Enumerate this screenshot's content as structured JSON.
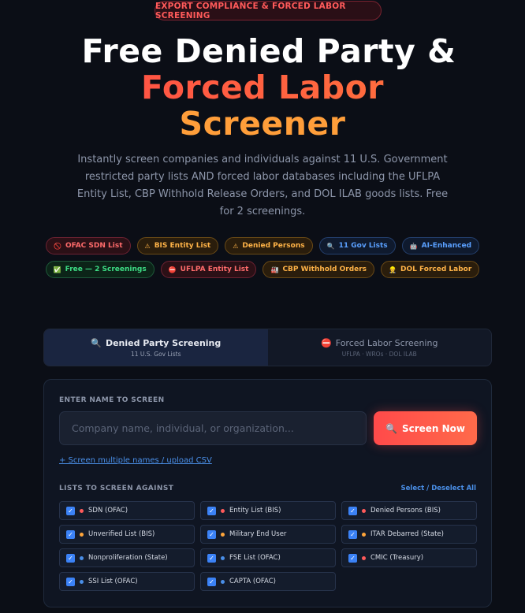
{
  "badge": "EXPORT COMPLIANCE & FORCED LABOR SCREENING",
  "hero": {
    "line1": "Free Denied Party &",
    "line2": "Forced Labor",
    "line3": "Screener"
  },
  "subtitle": "Instantly screen companies and individuals against 11 U.S. Government restricted party lists AND forced labor databases including the UFLPA Entity List, CBP Withhold Release Orders, and DOL ILAB goods lists. Free for 2 screenings.",
  "tags_row1": [
    {
      "icon": "no-entry-icon",
      "glyph": "🚫",
      "label": "OFAC SDN List",
      "style": "red"
    },
    {
      "icon": "warning-icon",
      "glyph": "⚠",
      "label": "BIS Entity List",
      "style": "amber"
    },
    {
      "icon": "warning-icon",
      "glyph": "⚠",
      "label": "Denied Persons",
      "style": "amber"
    },
    {
      "icon": "search-icon",
      "glyph": "🔍",
      "label": "11 Gov Lists",
      "style": "blue"
    },
    {
      "icon": "robot-icon",
      "glyph": "🤖",
      "label": "AI-Enhanced",
      "style": "blue"
    }
  ],
  "tags_row2": [
    {
      "icon": "check-icon",
      "glyph": "✅",
      "label": "Free — 2 Screenings",
      "style": "green"
    },
    {
      "icon": "no-entry-icon",
      "glyph": "⛔",
      "label": "UFLPA Entity List",
      "style": "red"
    },
    {
      "icon": "factory-icon",
      "glyph": "🏭",
      "label": "CBP Withhold Orders",
      "style": "amber"
    },
    {
      "icon": "person-icon",
      "glyph": "👷",
      "label": "DOL Forced Labor",
      "style": "amber"
    }
  ],
  "tabs": [
    {
      "icon": "search-icon",
      "glyph": "🔍",
      "title": "Denied Party Screening",
      "sub": "11 U.S. Gov Lists"
    },
    {
      "icon": "no-entry-icon",
      "glyph": "⛔",
      "title": "Forced Labor Screening",
      "sub": "UFLPA · WROs · DOL ILAB"
    }
  ],
  "form": {
    "enter_label": "ENTER NAME TO SCREEN",
    "placeholder": "Company name, individual, or organization...",
    "button_label": "Screen Now",
    "csv_link": "+ Screen multiple names / upload CSV",
    "lists_label": "LISTS TO SCREEN AGAINST",
    "select_all": "Select / Deselect All"
  },
  "lists": [
    {
      "label": "SDN (OFAC)",
      "color": "#ff5a5a"
    },
    {
      "label": "Entity List (BIS)",
      "color": "#ff5a5a"
    },
    {
      "label": "Denied Persons (BIS)",
      "color": "#ff5a5a"
    },
    {
      "label": "Unverified List (BIS)",
      "color": "#ffa53a"
    },
    {
      "label": "Military End User",
      "color": "#ffa53a"
    },
    {
      "label": "ITAR Debarred (State)",
      "color": "#ffa53a"
    },
    {
      "label": "Nonproliferation (State)",
      "color": "#4a8fe8"
    },
    {
      "label": "FSE List (OFAC)",
      "color": "#4a8fe8"
    },
    {
      "label": "CMIC (Treasury)",
      "color": "#ff5a5a"
    },
    {
      "label": "SSI List (OFAC)",
      "color": "#4a8fe8"
    },
    {
      "label": "CAPTA (OFAC)",
      "color": "#4a8fe8"
    }
  ]
}
